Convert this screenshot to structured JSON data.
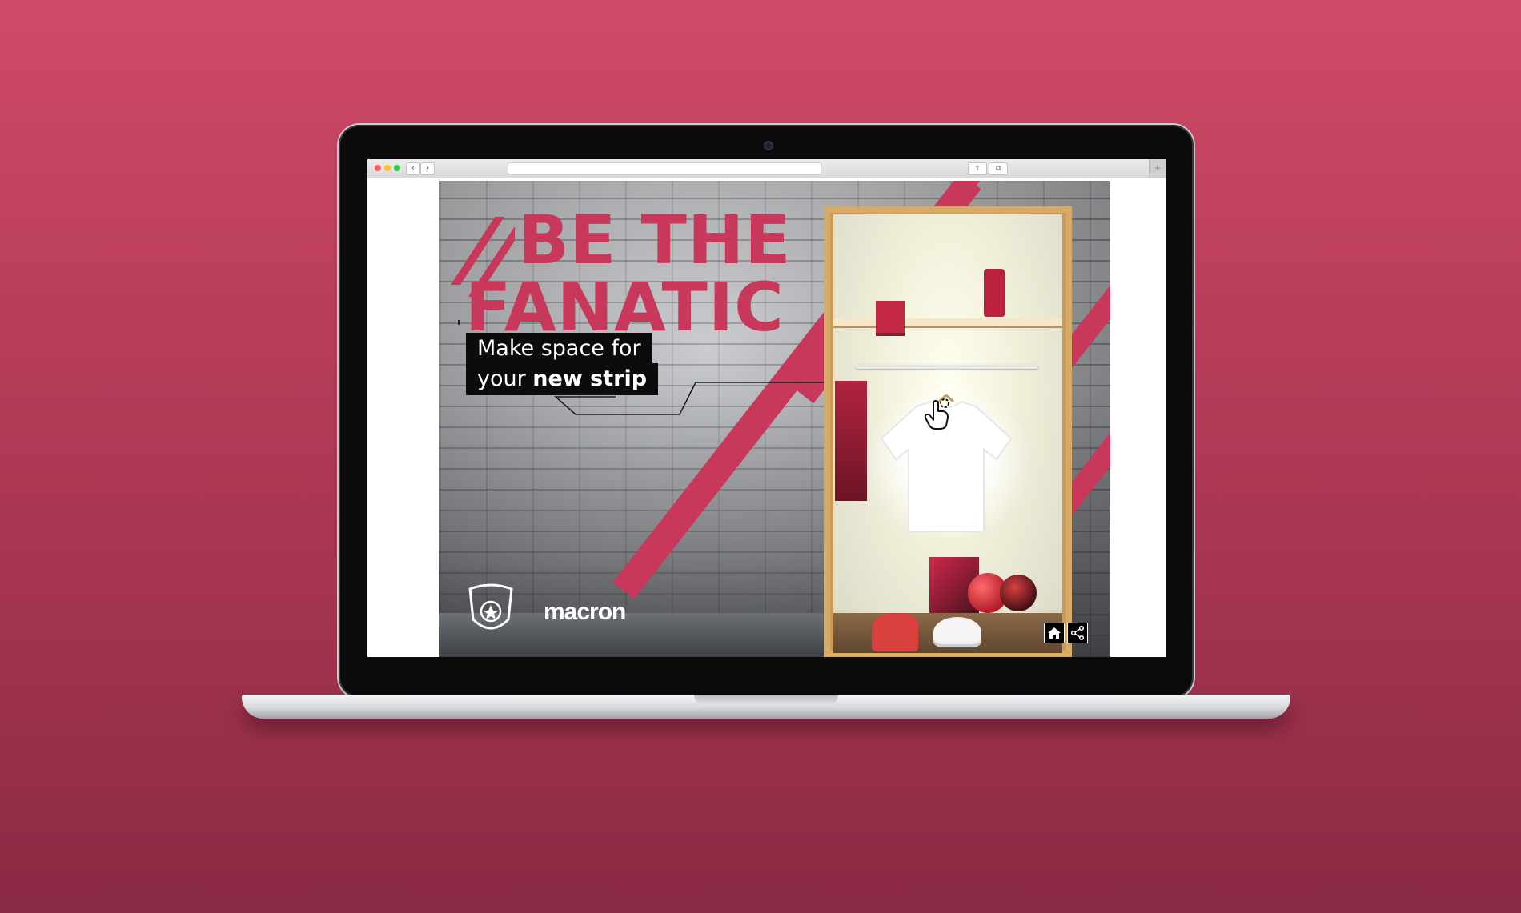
{
  "hero": {
    "title_line1": "BE THE",
    "title_line2": "FANATIC",
    "tagline_line1": "Make space for",
    "tagline_line2_regular": "your ",
    "tagline_line2_bold": "new strip",
    "logo_brand": "macron"
  },
  "browser": {
    "back_glyph": "‹",
    "forward_glyph": "›",
    "share_glyph": "⇪",
    "tabs_glyph": "⧉",
    "new_tab_glyph": "+"
  },
  "colors": {
    "background": "#c94663",
    "accent_red": "#c8385a",
    "tag_bg": "#0c0c0c"
  },
  "icons": [
    "home-icon",
    "share-icon",
    "pointer-hand-icon",
    "club-crest-logo"
  ]
}
